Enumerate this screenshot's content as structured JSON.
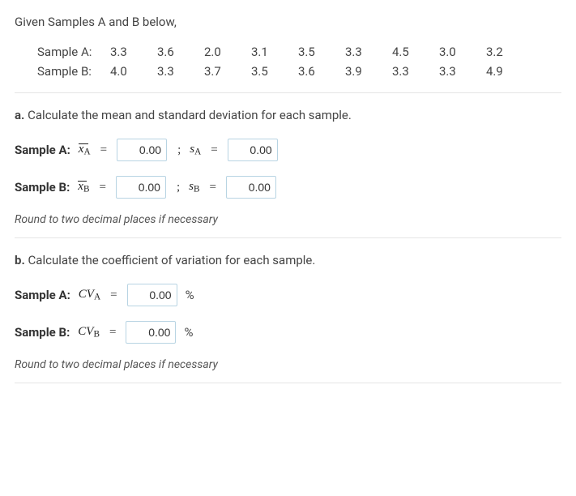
{
  "intro": "Given Samples A and B below,",
  "samples": {
    "A": {
      "label": "Sample A:",
      "values": [
        "3.3",
        "3.6",
        "2.0",
        "3.1",
        "3.5",
        "3.3",
        "4.5",
        "3.0",
        "3.2"
      ]
    },
    "B": {
      "label": "Sample B:",
      "values": [
        "4.0",
        "3.3",
        "3.7",
        "3.5",
        "3.6",
        "3.9",
        "3.3",
        "3.3",
        "4.9"
      ]
    }
  },
  "partA": {
    "letter": "a.",
    "prompt": "Calculate the mean and standard deviation for each sample.",
    "rowA": {
      "lead": "Sample A:",
      "mean_val": "0.00",
      "sd_val": "0.00"
    },
    "rowB": {
      "lead": "Sample B:",
      "mean_val": "0.00",
      "sd_val": "0.00"
    },
    "hint": "Round to two decimal places if necessary"
  },
  "partB": {
    "letter": "b.",
    "prompt": "Calculate the coefficient of variation for each sample.",
    "rowA": {
      "lead": "Sample A:",
      "cv_val": "0.00"
    },
    "rowB": {
      "lead": "Sample B:",
      "cv_val": "0.00"
    },
    "pct": "%",
    "hint": "Round to two decimal places if necessary"
  },
  "symbols": {
    "eq": "=",
    "semi": ";"
  }
}
